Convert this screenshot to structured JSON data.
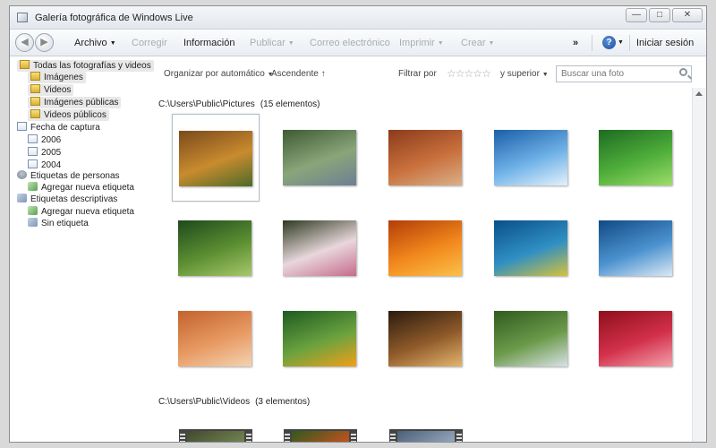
{
  "window": {
    "title": "Galería fotográfica de Windows Live"
  },
  "toolbar": {
    "file": "Archivo",
    "fix": "Corregir",
    "info": "Información",
    "publish": "Publicar",
    "email": "Correo electrónico",
    "print": "Imprimir",
    "create": "Crear",
    "more": "»",
    "signin": "Iniciar sesión"
  },
  "sidebar": {
    "all": "Todas las fotografías y videos",
    "images": "Imágenes",
    "videos": "Videos",
    "public_images": "Imágenes públicas",
    "public_videos": "Videos públicos",
    "date_taken": "Fecha de captura",
    "years": [
      "2006",
      "2005",
      "2004"
    ],
    "people_tags": "Etiquetas de personas",
    "add_tag_people": "Agregar nueva etiqueta",
    "descriptive_tags": "Etiquetas descriptivas",
    "add_tag_desc": "Agregar nueva etiqueta",
    "no_tag": "Sin etiqueta"
  },
  "filterbar": {
    "organize": "Organizar por automático",
    "ascending": "Ascendente",
    "filter_by": "Filtrar por",
    "and_above": "y superior",
    "search_placeholder": "Buscar una foto"
  },
  "sections": {
    "pictures_path": "C:\\Users\\Public\\Pictures",
    "pictures_count": "(15 elementos)",
    "videos_path": "C:\\Users\\Public\\Videos",
    "videos_count": "(3 elementos)"
  },
  "thumbnails": [
    {
      "name": "autumn-leaves",
      "colors": [
        "#7a4a1c",
        "#c98b2e",
        "#4d6a2a"
      ]
    },
    {
      "name": "creek",
      "colors": [
        "#3e5b33",
        "#8aa57a",
        "#6c7f92"
      ]
    },
    {
      "name": "desert-buttes",
      "colors": [
        "#8b3b1c",
        "#c9703c",
        "#d9b08a"
      ]
    },
    {
      "name": "icebergs",
      "colors": [
        "#1a5fa8",
        "#6fb2e8",
        "#e4f1fb"
      ]
    },
    {
      "name": "green-leaves",
      "colors": [
        "#1d6b22",
        "#4fae3a",
        "#9edc6b"
      ]
    },
    {
      "name": "forest-path",
      "colors": [
        "#1e4a1c",
        "#5c8f32",
        "#a8c86a"
      ]
    },
    {
      "name": "frangipani",
      "colors": [
        "#2d3a1f",
        "#e8d7dc",
        "#c56b8c"
      ]
    },
    {
      "name": "orange-flowers",
      "colors": [
        "#b43d07",
        "#f2891d",
        "#fbc04a"
      ]
    },
    {
      "name": "sea-turtle",
      "colors": [
        "#0a4f88",
        "#2f8fc4",
        "#d6c23a"
      ]
    },
    {
      "name": "whale-tail",
      "colors": [
        "#114a85",
        "#4b92cf",
        "#dbe9f4"
      ]
    },
    {
      "name": "oryx-dunes",
      "colors": [
        "#c3622c",
        "#e89a63",
        "#f3d3b1"
      ]
    },
    {
      "name": "toucan",
      "colors": [
        "#1e5b22",
        "#6aa23f",
        "#f0a01a"
      ]
    },
    {
      "name": "tree-sunset",
      "colors": [
        "#2b1b0e",
        "#8f5a2a",
        "#e3b56f"
      ]
    },
    {
      "name": "waterfall",
      "colors": [
        "#2f5b1e",
        "#6c9a4a",
        "#d8e2e6"
      ]
    },
    {
      "name": "red-leaves",
      "colors": [
        "#8f0f1c",
        "#d2304a",
        "#f3a0aa"
      ]
    }
  ],
  "videos": [
    {
      "name": "video-bear",
      "colors": [
        "#3f4a2e",
        "#7a8a55"
      ]
    },
    {
      "name": "video-butterfly",
      "colors": [
        "#2e5a1e",
        "#d8501e"
      ]
    },
    {
      "name": "video-lake",
      "colors": [
        "#4b5f78",
        "#9db0c4"
      ]
    }
  ]
}
